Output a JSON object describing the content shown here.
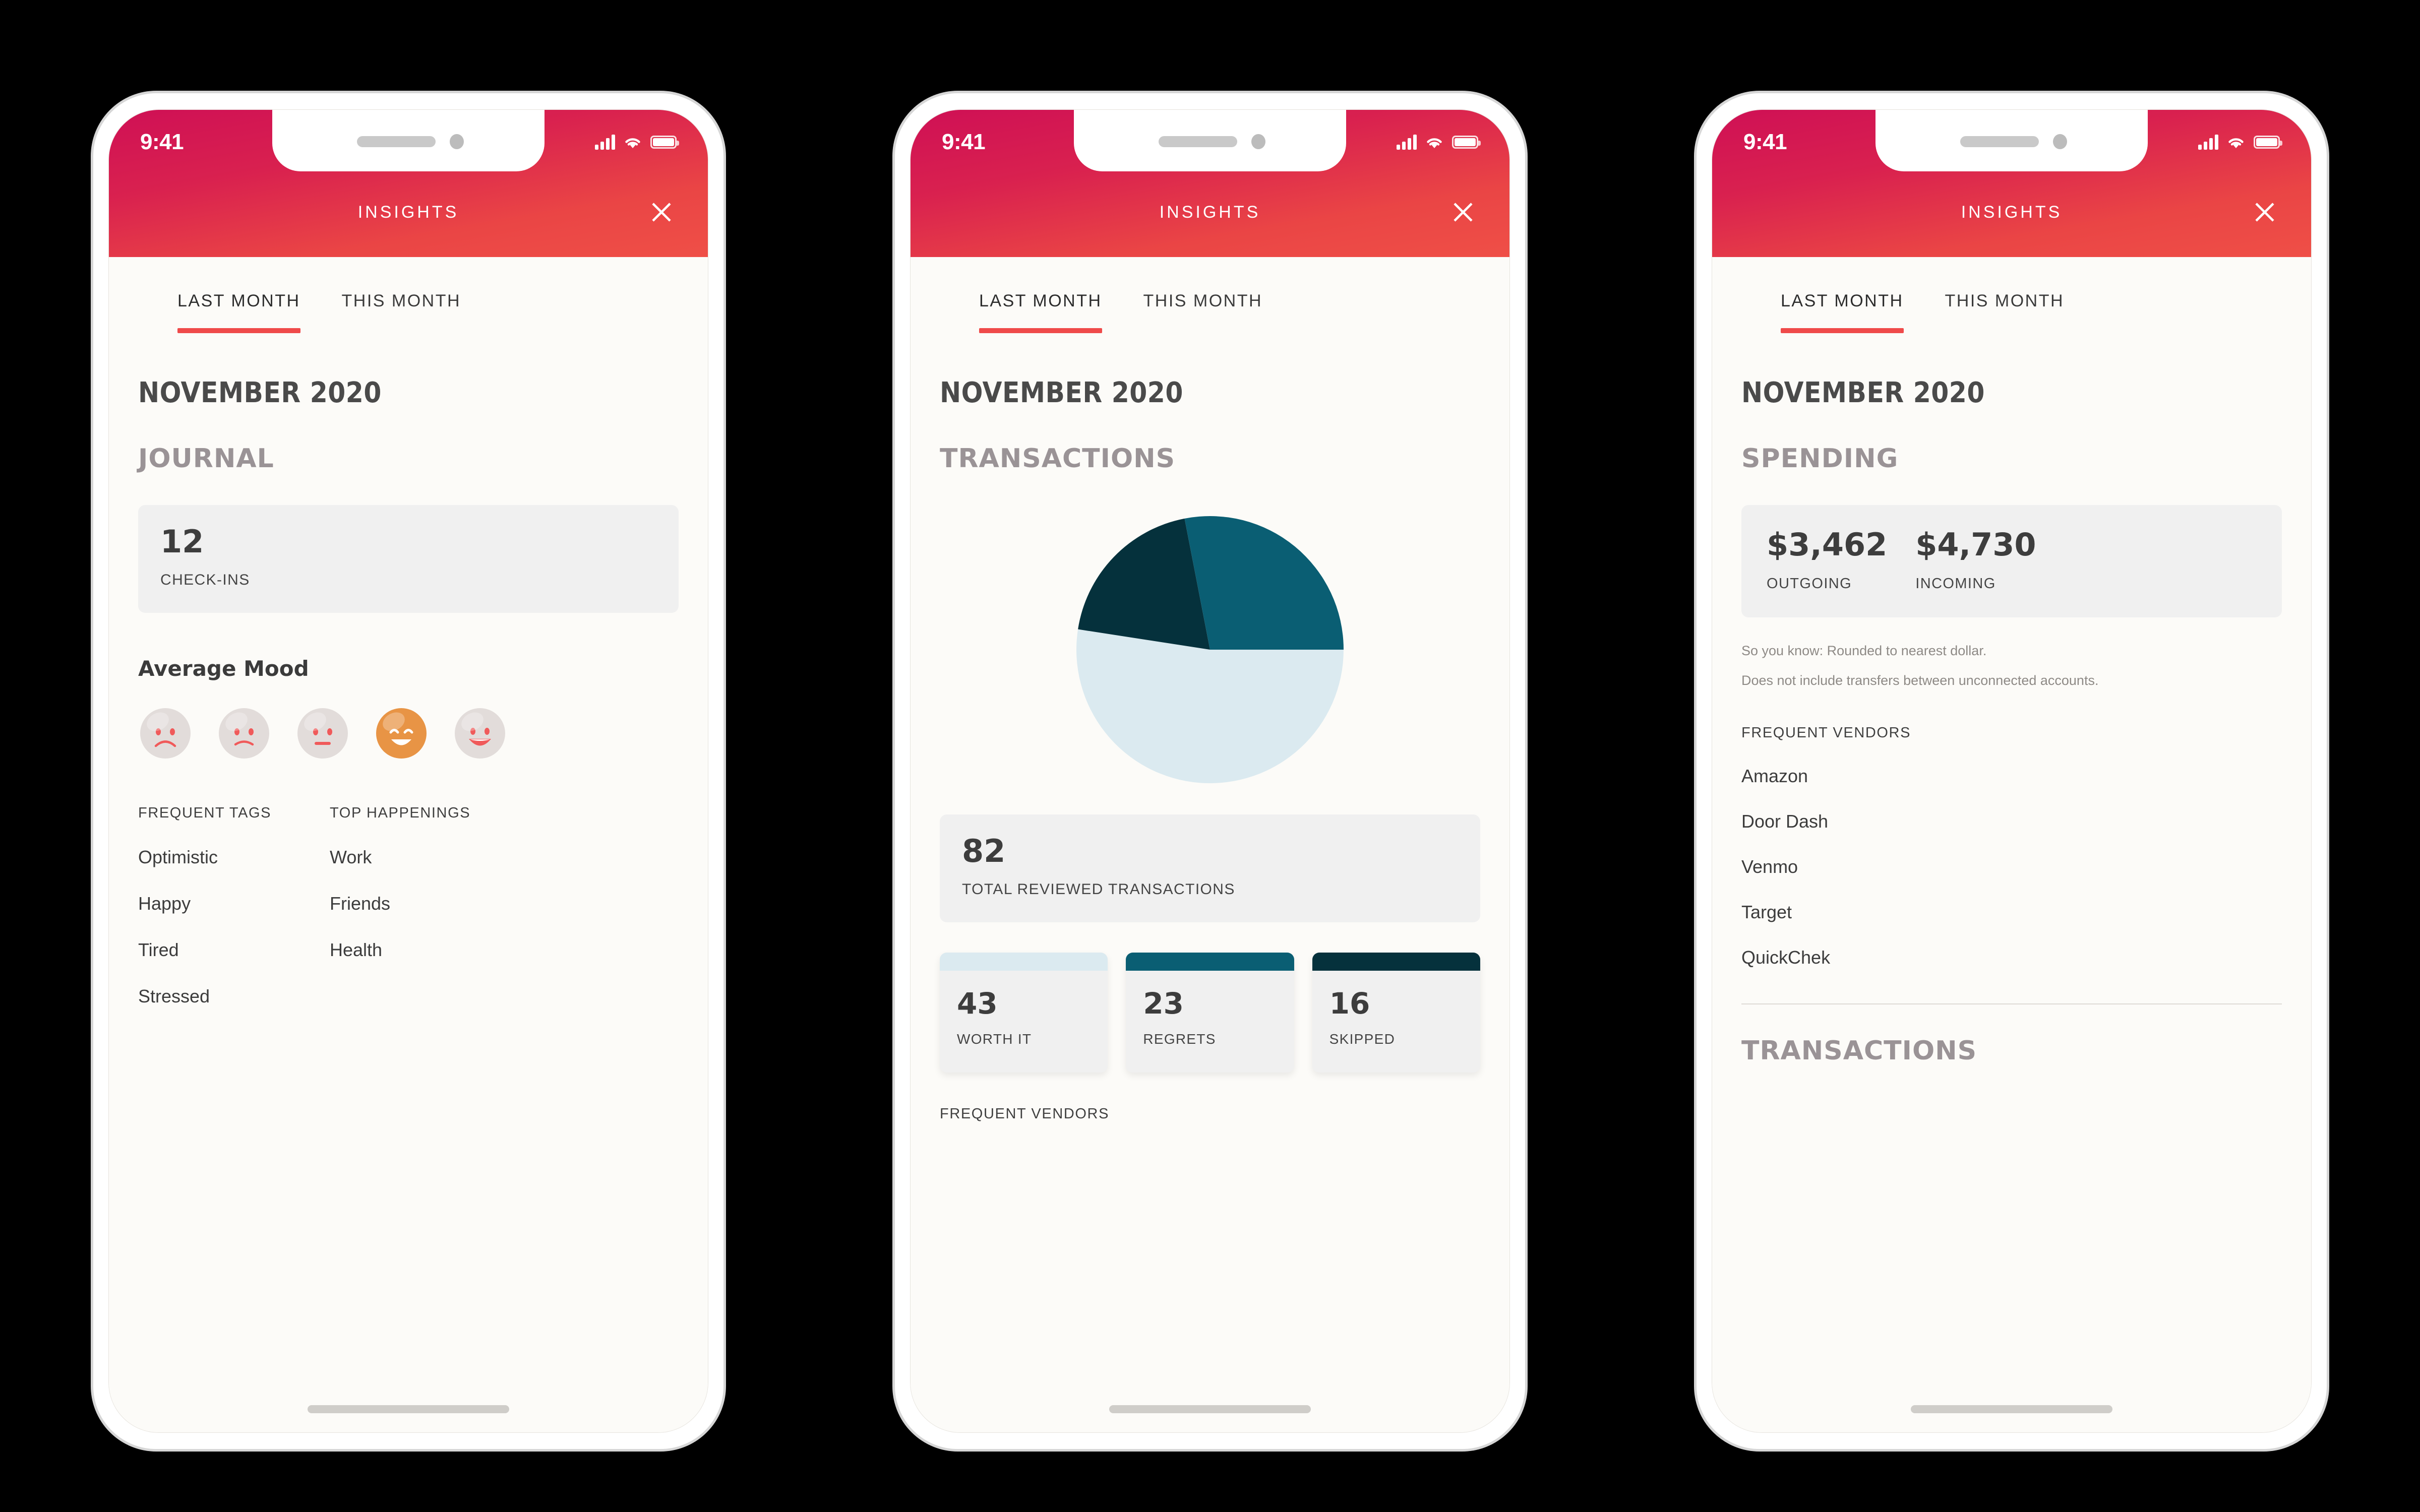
{
  "accent": {
    "red": "#ef4a4a",
    "header_from": "#cf1055",
    "header_to": "#ef4f47",
    "orange": "#e89445",
    "teal_dark": "#05313c",
    "teal_mid": "#0a5e73",
    "teal_light": "#dbeaf0"
  },
  "status_bar": {
    "time": "9:41",
    "signal_icon": "cellular-signal-icon",
    "wifi_icon": "wifi-icon",
    "battery_icon": "battery-icon"
  },
  "navbar": {
    "title": "INSIGHTS",
    "close_icon": "close-icon"
  },
  "tabs": [
    {
      "label": "LAST MONTH",
      "active": true
    },
    {
      "label": "THIS MONTH",
      "active": false
    }
  ],
  "month": "NOVEMBER 2020",
  "screen1": {
    "section": "JOURNAL",
    "checkins": {
      "value": "12",
      "label": "CHECK-INS"
    },
    "mood_title": "Average Mood",
    "moods": [
      {
        "name": "very-sad",
        "selected": false
      },
      {
        "name": "sad",
        "selected": false
      },
      {
        "name": "neutral",
        "selected": false
      },
      {
        "name": "happy",
        "selected": true
      },
      {
        "name": "very-happy",
        "selected": false
      }
    ],
    "frequent_tags_head": "FREQUENT TAGS",
    "frequent_tags": [
      "Optimistic",
      "Happy",
      "Tired",
      "Stressed"
    ],
    "top_happenings_head": "TOP HAPPENINGS",
    "top_happenings": [
      "Work",
      "Friends",
      "Health"
    ]
  },
  "screen2": {
    "section": "TRANSACTIONS",
    "total": {
      "value": "82",
      "label": "TOTAL REVIEWED TRANSACTIONS"
    },
    "breakdown": [
      {
        "value": "43",
        "label": "WORTH IT",
        "color": "#dbeaf0"
      },
      {
        "value": "23",
        "label": "REGRETS",
        "color": "#0a5e73"
      },
      {
        "value": "16",
        "label": "SKIPPED",
        "color": "#05313c"
      }
    ],
    "frequent_vendors_head": "FREQUENT VENDORS"
  },
  "screen3": {
    "section": "SPENDING",
    "outgoing": {
      "amount": "$3,462",
      "label": "OUTGOING"
    },
    "incoming": {
      "amount": "$4,730",
      "label": "INCOMING"
    },
    "note_line1": "So you know: Rounded to nearest dollar.",
    "note_line2": "Does not include transfers between unconnected accounts.",
    "frequent_vendors_head": "FREQUENT VENDORS",
    "vendors": [
      "Amazon",
      "Door Dash",
      "Venmo",
      "Target",
      "QuickChek"
    ],
    "next_section": "TRANSACTIONS"
  },
  "chart_data": {
    "type": "pie",
    "title": "TRANSACTIONS",
    "categories": [
      "WORTH IT",
      "REGRETS",
      "SKIPPED"
    ],
    "values": [
      43,
      23,
      16
    ],
    "total": 82,
    "colors": [
      "#dbeaf0",
      "#0a5e73",
      "#05313c"
    ],
    "legend": "none",
    "start_angle_deg": 0,
    "percentages": [
      52.4,
      28.0,
      19.5
    ]
  }
}
